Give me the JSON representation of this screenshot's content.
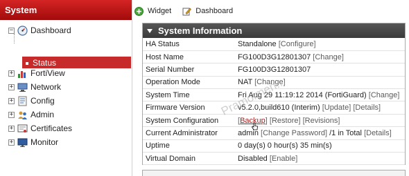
{
  "sidebar": {
    "title": "System",
    "items": [
      {
        "label": "Dashboard",
        "expander": "−",
        "icon": "dashboard-gauge-icon"
      },
      {
        "label": "Status",
        "selected": true
      },
      {
        "label": "FortiView",
        "expander": "+",
        "icon": "fortiview-chart-icon"
      },
      {
        "label": "Network",
        "expander": "+",
        "icon": "network-icon"
      },
      {
        "label": "Config",
        "expander": "+",
        "icon": "config-gear-icon"
      },
      {
        "label": "Admin",
        "expander": "+",
        "icon": "admin-users-icon"
      },
      {
        "label": "Certificates",
        "expander": "+",
        "icon": "certificates-icon"
      },
      {
        "label": "Monitor",
        "expander": "+",
        "icon": "monitor-icon"
      }
    ]
  },
  "toolbar": {
    "widget_label": "Widget",
    "dashboard_label": "Dashboard"
  },
  "panel": {
    "title": "System Information",
    "rows": [
      {
        "label": "HA Status",
        "value": "Standalone",
        "links": [
          "Configure"
        ]
      },
      {
        "label": "Host Name",
        "value": "FG100D3G12801307",
        "links": [
          "Change"
        ]
      },
      {
        "label": "Serial Number",
        "value": "FG100D3G12801307",
        "links": []
      },
      {
        "label": "Operation Mode",
        "value": "NAT",
        "links": [
          "Change"
        ]
      },
      {
        "label": "System Time",
        "value": "Fri Aug 29 11:19:12 2014 (FortiGuard)",
        "links": [
          "Change"
        ]
      },
      {
        "label": "Firmware Version",
        "value": "v5.2.0,build610 (Interim)",
        "links": [
          "Update",
          "Details"
        ]
      },
      {
        "label": "System Configuration",
        "value": "",
        "links": [
          "Backup",
          "Restore",
          "Revisions"
        ]
      },
      {
        "label": "Current Administrator",
        "value": "admin",
        "links": [
          "Change Password"
        ],
        "suffix": "/1 in Total",
        "links_after": [
          "Details"
        ]
      },
      {
        "label": "Uptime",
        "value": "0 day(s) 0 hour(s) 35 min(s)",
        "links": []
      },
      {
        "label": "Virtual Domain",
        "value": "Disabled",
        "links": [
          "Enable"
        ]
      }
    ]
  },
  "watermark": "Pramoimen..."
}
